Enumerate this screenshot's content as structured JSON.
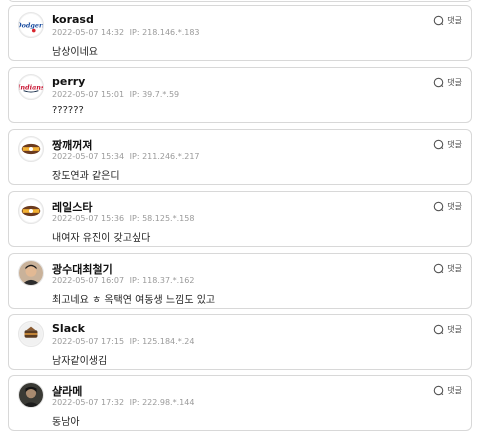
{
  "reply_label": "댓글",
  "comments": [
    {
      "name": "korasd",
      "datetime": "2022-05-07 14:32",
      "ip": "IP: 218.146.*.183",
      "text": "남상이네요",
      "avatar": "dodgers-logo-icon"
    },
    {
      "name": "perry",
      "datetime": "2022-05-07 15:01",
      "ip": "IP: 39.7.*.59",
      "text": "??????",
      "avatar": "team-logo-icon"
    },
    {
      "name": "짱깨꺼져",
      "datetime": "2022-05-07 15:34",
      "ip": "IP: 211.246.*.217",
      "text": "장도연과 같은디",
      "avatar": "baseball-emblem-icon"
    },
    {
      "name": "레일스타",
      "datetime": "2022-05-07 15:36",
      "ip": "IP: 58.125.*.158",
      "text": "내여자 유진이 갖고싶다",
      "avatar": "baseball-emblem-icon"
    },
    {
      "name": "광수대최철기",
      "datetime": "2022-05-07 16:07",
      "ip": "IP: 118.37.*.162",
      "text": "최고네요 ㅎ 옥택연 여동생 느낌도 있고",
      "avatar": "person-photo"
    },
    {
      "name": "Slack",
      "datetime": "2022-05-07 17:15",
      "ip": "IP: 125.184.*.24",
      "text": "남자같이생김",
      "avatar": "emblem-icon"
    },
    {
      "name": "샬라메",
      "datetime": "2022-05-07 17:32",
      "ip": "IP: 222.98.*.144",
      "text": "동남아",
      "avatar": "person-photo-dark"
    }
  ]
}
